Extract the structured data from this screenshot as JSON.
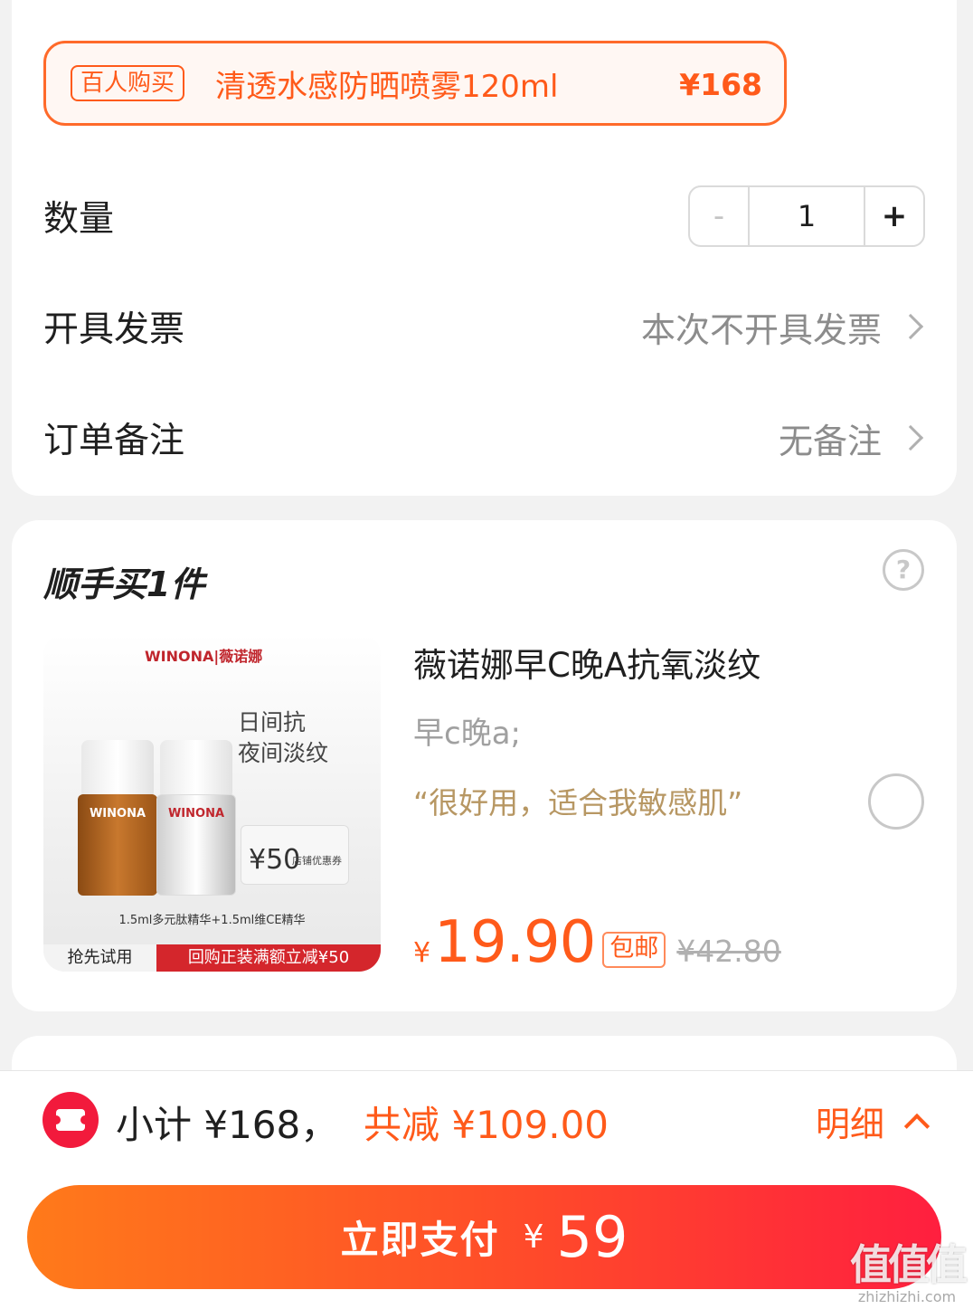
{
  "promo": {
    "tag": "百人购买",
    "name": "清透水感防晒喷雾120ml",
    "price": "¥168"
  },
  "quantity": {
    "label": "数量",
    "minus": "-",
    "value": "1",
    "plus": "+"
  },
  "invoice": {
    "label": "开具发票",
    "value": "本次不开具发票"
  },
  "remark": {
    "label": "订单备注",
    "value": "无备注"
  },
  "addon": {
    "title": "顺手买1件",
    "help": "?",
    "image": {
      "brand": "WINONA|薇诺娜",
      "slogan_line1": "日间抗",
      "slogan_line2": "夜间淡纹",
      "bottle1_label": "WINONA",
      "bottle2_label": "WINONA",
      "coupon_amount": "¥50",
      "coupon_text": "店铺优惠券",
      "caption": "1.5ml多元肽精华+1.5ml维CE精华",
      "trial_tag": "抢先试用",
      "rebuy_tag": "回购正装满额立减¥50"
    },
    "product_name": "薇诺娜早C晚A抗氧淡纹",
    "spec": "早c晚a;",
    "review": "“很好用，适合我敏感肌”",
    "price_symbol": "¥",
    "price": "19.90",
    "shipping_tag": "包邮",
    "original_price": "¥42.80"
  },
  "footer": {
    "subtotal": "小计 ¥168，",
    "discount": "共减 ¥109.00",
    "detail": "明细",
    "pay_label": "立即支付",
    "pay_currency": "¥",
    "pay_amount": "59"
  },
  "watermark": {
    "logo": "值值值",
    "url": "zhizhizhi.com"
  },
  "colors": {
    "accent": "#ff5a1a",
    "pay_gradient_start": "#ff7a1a",
    "pay_gradient_end": "#ff1f3f",
    "review": "#b79763",
    "coupon_icon": "#f21a3c"
  }
}
